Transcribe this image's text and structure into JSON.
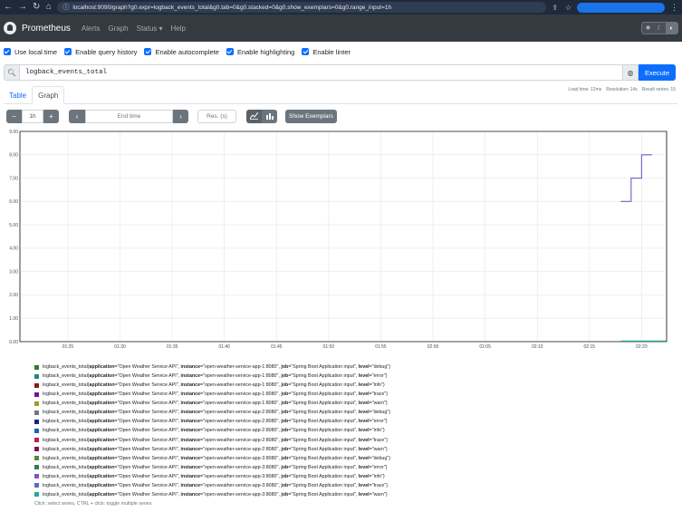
{
  "browser": {
    "url": "localhost:9090/graph?g0.expr=logback_events_total&g0.tab=0&g0.stacked=0&g0.show_exemplars=0&g0.range_input=1h",
    "back_icon": "arrow-left-icon",
    "forward_icon": "arrow-right-icon",
    "reload_icon": "reload-icon",
    "home_icon": "home-icon"
  },
  "nav": {
    "brand": "Prometheus",
    "links": [
      "Alerts",
      "Graph",
      "Status ▾",
      "Help"
    ]
  },
  "options": [
    {
      "label": "Use local time",
      "checked": true
    },
    {
      "label": "Enable query history",
      "checked": true
    },
    {
      "label": "Enable autocomplete",
      "checked": true
    },
    {
      "label": "Enable highlighting",
      "checked": true
    },
    {
      "label": "Enable linter",
      "checked": true
    }
  ],
  "query": {
    "expression": "logback_events_total",
    "execute_label": "Execute"
  },
  "stats": {
    "load_time": "Load time: 12ms",
    "resolution": "Resolution: 14s",
    "result_series": "Result series: 15"
  },
  "tabs": {
    "table": "Table",
    "graph": "Graph"
  },
  "controls": {
    "minus": "−",
    "range": "1h",
    "plus": "+",
    "prev": "‹",
    "end_time_placeholder": "End time",
    "next": "›",
    "res_placeholder": "Res. (s)",
    "show_exemplars": "Show Exemplars"
  },
  "chart_data": {
    "type": "line",
    "y_ticks": [
      "9.00",
      "8.00",
      "7.00",
      "6.00",
      "5.00",
      "4.00",
      "3.00",
      "2.00",
      "1.00",
      "0.00"
    ],
    "ylim": [
      0,
      9
    ],
    "x_ticks": [
      "01:25",
      "01:30",
      "01:35",
      "01:40",
      "01:45",
      "01:50",
      "01:55",
      "02:00",
      "02:05",
      "02:10",
      "02:15",
      "02:20"
    ],
    "grid": true,
    "series_step": {
      "name": "level=\"info\"",
      "x": [
        "02:18",
        "02:19",
        "02:19",
        "02:19.5",
        "02:19.5",
        "02:20",
        "02:20",
        "02:21"
      ],
      "values": [
        6,
        6,
        7,
        7,
        7,
        7,
        8,
        8
      ]
    },
    "series_flat_value": 0
  },
  "legend": {
    "metric": "logback_events_total",
    "items": [
      {
        "color": "#2e7d32",
        "instance": "open-weather-service-app-1:8080",
        "level": "debug"
      },
      {
        "color": "#1b8a8a",
        "instance": "open-weather-service-app-1:8080",
        "level": "error"
      },
      {
        "color": "#8b1a1a",
        "instance": "open-weather-service-app-1:8080",
        "level": "info"
      },
      {
        "color": "#6a1b9a",
        "instance": "open-weather-service-app-1:8080",
        "level": "trace"
      },
      {
        "color": "#9e9d24",
        "instance": "open-weather-service-app-1:8080",
        "level": "warn"
      },
      {
        "color": "#777777",
        "instance": "open-weather-service-app-2:8080",
        "level": "debug"
      },
      {
        "color": "#1a237e",
        "instance": "open-weather-service-app-2:8080",
        "level": "error"
      },
      {
        "color": "#1565c0",
        "instance": "open-weather-service-app-2:8080",
        "level": "info"
      },
      {
        "color": "#c2185b",
        "instance": "open-weather-service-app-2:8080",
        "level": "trace"
      },
      {
        "color": "#880e4f",
        "instance": "open-weather-service-app-2:8080",
        "level": "warn"
      },
      {
        "color": "#558b2f",
        "instance": "open-weather-service-app-3:8080",
        "level": "debug"
      },
      {
        "color": "#2e7d5b",
        "instance": "open-weather-service-app-3:8080",
        "level": "error"
      },
      {
        "color": "#7e57c2",
        "instance": "open-weather-service-app-3:8080",
        "level": "info"
      },
      {
        "color": "#5c6bc0",
        "instance": "open-weather-service-app-3:8080",
        "level": "trace"
      },
      {
        "color": "#26a69a",
        "instance": "open-weather-service-app-3:8080",
        "level": "warn"
      }
    ],
    "application": "Open Weather Service API",
    "job": "Spring Boot Application input",
    "help": "Click: select series, CTRL + click: toggle multiple series"
  }
}
